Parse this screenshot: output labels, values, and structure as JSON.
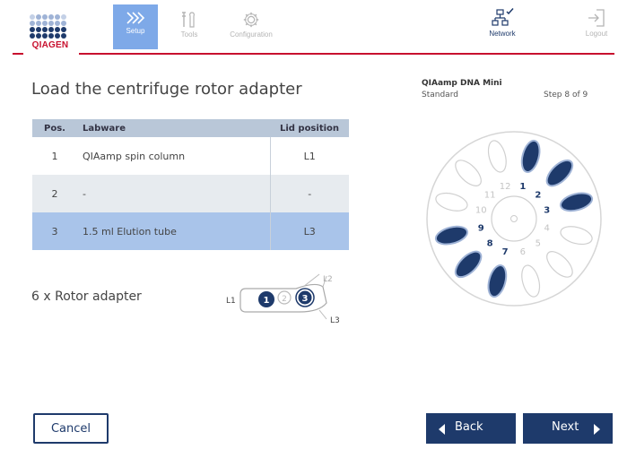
{
  "brand": {
    "logo_text": "QIAGEN",
    "red": "#c8102e",
    "navy": "#1e3a6b",
    "active_tab": "#7ea9e8"
  },
  "nav": {
    "setup": {
      "label": "Setup",
      "icon": "double-chevron-right-icon",
      "active": true
    },
    "tools": {
      "label": "Tools",
      "icon": "tools-icon"
    },
    "configuration": {
      "label": "Configuration",
      "icon": "gear-icon"
    },
    "network": {
      "label": "Network",
      "icon": "network-icon"
    },
    "logout": {
      "label": "Logout",
      "icon": "logout-icon"
    }
  },
  "page": {
    "title": "Load the centrifuge rotor adapter"
  },
  "protocol": {
    "name": "QIAamp DNA Mini",
    "type": "Standard",
    "step": "Step 8 of 9"
  },
  "table": {
    "headers": {
      "pos": "Pos.",
      "labware": "Labware",
      "lid": "Lid position"
    },
    "rows": [
      {
        "pos": "1",
        "labware": "QIAamp spin column",
        "lid": "L1"
      },
      {
        "pos": "2",
        "labware": "-",
        "lid": "-"
      },
      {
        "pos": "3",
        "labware": "1.5 ml Elution tube",
        "lid": "L3"
      }
    ]
  },
  "adapter": {
    "label": "6 x Rotor adapter",
    "lid_labels": [
      "L1",
      "L2",
      "L3"
    ],
    "positions": [
      "1",
      "2",
      "3"
    ]
  },
  "rotor": {
    "numbers": [
      "1",
      "2",
      "3",
      "4",
      "5",
      "6",
      "7",
      "8",
      "9",
      "10",
      "11",
      "12"
    ],
    "occupied": [
      1,
      2,
      3,
      7,
      8,
      9
    ]
  },
  "buttons": {
    "cancel": "Cancel",
    "back": "Back",
    "next": "Next"
  }
}
